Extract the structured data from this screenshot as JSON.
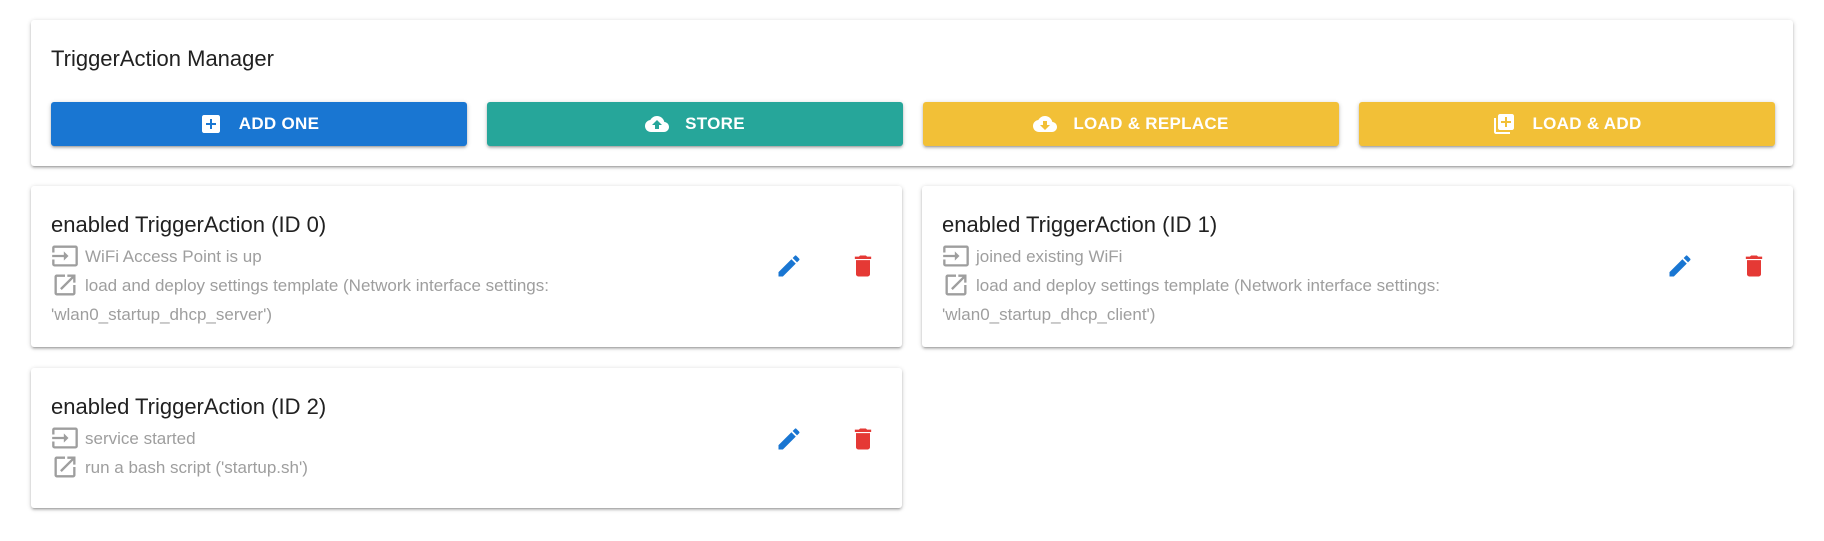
{
  "manager": {
    "title": "TriggerAction Manager",
    "buttons": {
      "add_one": "ADD ONE",
      "store": "STORE",
      "load_replace": "LOAD & REPLACE",
      "load_add": "LOAD & ADD"
    }
  },
  "trigger_actions": [
    {
      "title": "enabled TriggerAction (ID 0)",
      "trigger": "WiFi Access Point is up",
      "action": "load and deploy settings template (Network interface settings: 'wlan0_startup_dhcp_server')"
    },
    {
      "title": "enabled TriggerAction (ID 1)",
      "trigger": "joined existing WiFi",
      "action": "load and deploy settings template (Network interface settings: 'wlan0_startup_dhcp_client')"
    },
    {
      "title": "enabled TriggerAction (ID 2)",
      "trigger": "service started",
      "action": "run a bash script ('startup.sh')"
    }
  ],
  "icons": {
    "add": "add-box-icon",
    "store": "cloud-upload-icon",
    "load_replace": "cloud-download-icon",
    "load_add": "library-add-icon",
    "trigger": "input-icon",
    "action": "open-in-new-icon",
    "edit": "pencil-icon",
    "delete": "trash-icon"
  },
  "colors": {
    "primary": "#1976d2",
    "teal": "#26a69a",
    "warning": "#f2c037",
    "negative": "#e53935",
    "muted_text": "#9e9e9e"
  }
}
